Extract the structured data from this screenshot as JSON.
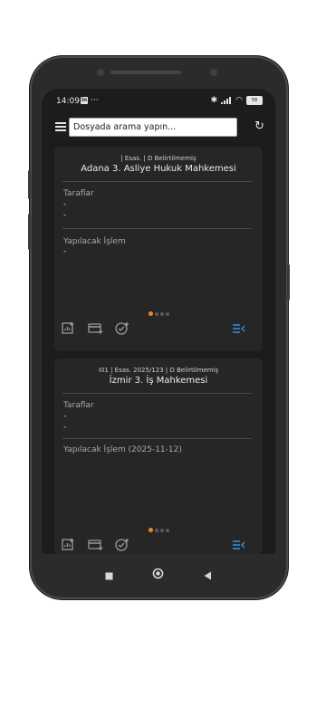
{
  "status_bar": {
    "time": "14:09",
    "app_badge": "in",
    "dots": "···",
    "battery": "58"
  },
  "toolbar": {
    "search_placeholder": "Dosyada arama yapın..."
  },
  "cards": [
    {
      "meta": "| Esas.  | D Belirtilmemiş",
      "court": "Adana 3. Asliye Hukuk Mahkemesi",
      "parties_label": "Taraflar",
      "party_1": "-",
      "party_2": "-",
      "todo_label": "Yapılacak İşlem",
      "todo_value": "-"
    },
    {
      "meta": "I01 | Esas. 2025/123 | D Belirtilmemiş",
      "court": "İzmir 3. İş Mahkemesi",
      "parties_label": "Taraflar",
      "party_1": "-",
      "party_2": "-",
      "todo_label": "Yapılacak İşlem (2025-11-12)"
    }
  ],
  "colors": {
    "accent_orange": "#e8892c",
    "accent_blue": "#3b8fd6",
    "background": "#1c1c1c",
    "card": "#262626"
  }
}
